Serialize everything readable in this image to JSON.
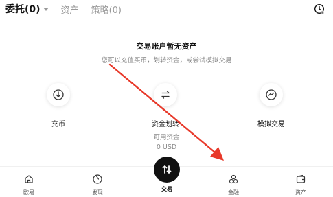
{
  "tabs": [
    {
      "label": "委托(0)",
      "active": true
    },
    {
      "label": "资产",
      "active": false
    },
    {
      "label": "策略(0)",
      "active": false
    }
  ],
  "empty_state": {
    "title": "交易账户暂无资产",
    "subtitle": "您可以充值买币，划转资金，或尝试模拟交易"
  },
  "actions": [
    {
      "label": "充币",
      "icon": "download-icon"
    },
    {
      "label": "资金划转",
      "icon": "transfer-icon"
    },
    {
      "label": "模拟交易",
      "icon": "simulate-icon"
    }
  ],
  "available": {
    "label": "可用资金",
    "value": "0 USD"
  },
  "bottom_nav": [
    {
      "label": "欧易",
      "icon": "home-icon"
    },
    {
      "label": "发现",
      "icon": "discover-icon"
    },
    {
      "label": "交易",
      "icon": "trade-icon",
      "active": true
    },
    {
      "label": "金融",
      "icon": "finance-icon"
    },
    {
      "label": "资产",
      "icon": "wallet-icon"
    }
  ],
  "colors": {
    "annotation_arrow": "#e8392a",
    "accent": "#111111"
  }
}
